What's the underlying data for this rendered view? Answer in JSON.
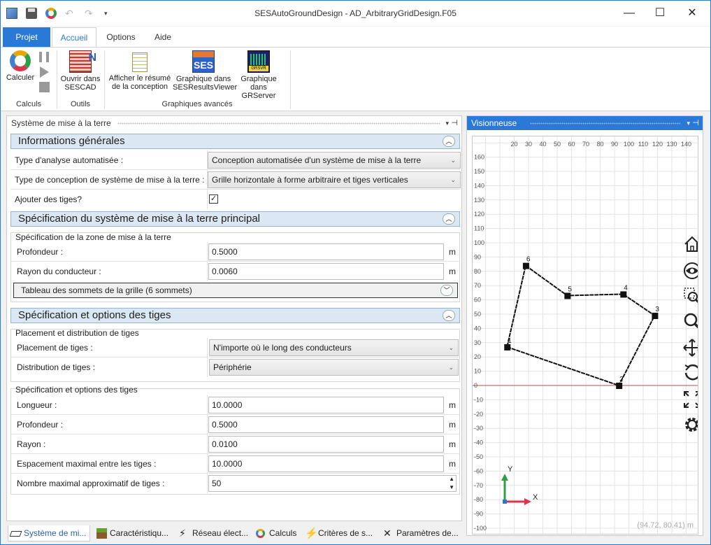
{
  "window": {
    "title": "SESAutoGroundDesign - AD_ArbitraryGridDesign.F05"
  },
  "ribbon_tabs": [
    "Projet",
    "Accueil",
    "Options",
    "Aide"
  ],
  "ribbon": {
    "calculer": "Calculer",
    "ouvrir_sescad_1": "Ouvrir dans",
    "ouvrir_sescad_2": "SESCAD",
    "afficher_1": "Afficher le résumé",
    "afficher_2": "de la conception",
    "graph_viewer_1": "Graphique dans",
    "graph_viewer_2": "SESResultsViewer",
    "graph_server_1": "Graphique",
    "graph_server_2": "dans GRServer",
    "group_calculs": "Calculs",
    "group_outils": "Outils",
    "group_graphiques": "Graphiques avancés"
  },
  "left_pane": {
    "title": "Système de mise à la terre",
    "sec1": "Informations générales",
    "type_analyse_label": "Type d'analyse automatisée :",
    "type_analyse_value": "Conception automatisée d'un système de mise à la terre",
    "type_conception_label": "Type de conception de système de mise à la terre :",
    "type_conception_value": "Grille horizontale à forme arbitraire et tiges verticales",
    "ajouter_tiges_label": "Ajouter des tiges?",
    "sec2": "Spécification du système de mise à la terre principal",
    "zone_group": "Spécification de la zone de mise à la terre",
    "profondeur_label": "Profondeur :",
    "profondeur_value": "0.5000",
    "rayon_cond_label": "Rayon du conducteur :",
    "rayon_cond_value": "0.0060",
    "tableau_label": "Tableau des sommets de la grille (6 sommets)",
    "sec3": "Spécification et options des tiges",
    "placement_group": "Placement et distribution de tiges",
    "placement_label": "Placement de tiges :",
    "placement_value": "N'importe où le long des conducteurs",
    "distribution_label": "Distribution de tiges :",
    "distribution_value": "Périphérie",
    "spec_group": "Spécification et options des tiges",
    "longueur_label": "Longueur :",
    "longueur_value": "10.0000",
    "prof_tige_label": "Profondeur :",
    "prof_tige_value": "0.5000",
    "rayon_label": "Rayon :",
    "rayon_value": "0.0100",
    "espacement_label": "Espacement maximal entre les tiges :",
    "espacement_value": "10.0000",
    "nombre_label": "Nombre maximal approximatif de tiges :",
    "nombre_value": "50",
    "unit": "m"
  },
  "viewer": {
    "title": "Visionneuse",
    "coords": "(94.72, 80.41) m",
    "axis_x": "X",
    "axis_y": "Y",
    "x_ticks": [
      "20",
      "30",
      "40",
      "50",
      "60",
      "70",
      "80",
      "90",
      "100",
      "110",
      "120",
      "130",
      "140"
    ],
    "y_ticks": [
      "160",
      "150",
      "140",
      "130",
      "120",
      "110",
      "100",
      "90",
      "80",
      "70",
      "60",
      "50",
      "40",
      "30",
      "20",
      "10",
      "0",
      "-10",
      "-20",
      "-30",
      "-40",
      "-50",
      "-60",
      "-70",
      "-80",
      "-90",
      "-100"
    ],
    "vertices": [
      {
        "label": "1",
        "x": 15,
        "y": 27
      },
      {
        "label": "2",
        "x": 93,
        "y": 0
      },
      {
        "label": "3",
        "x": 118,
        "y": 49
      },
      {
        "label": "4",
        "x": 96,
        "y": 64
      },
      {
        "label": "5",
        "x": 57,
        "y": 63
      },
      {
        "label": "6",
        "x": 28,
        "y": 84
      }
    ]
  },
  "bottom_tabs": [
    "Système de mi...",
    "Caractéristiqu...",
    "Réseau élect...",
    "Calculs",
    "Critères de s...",
    "Paramètres de..."
  ]
}
